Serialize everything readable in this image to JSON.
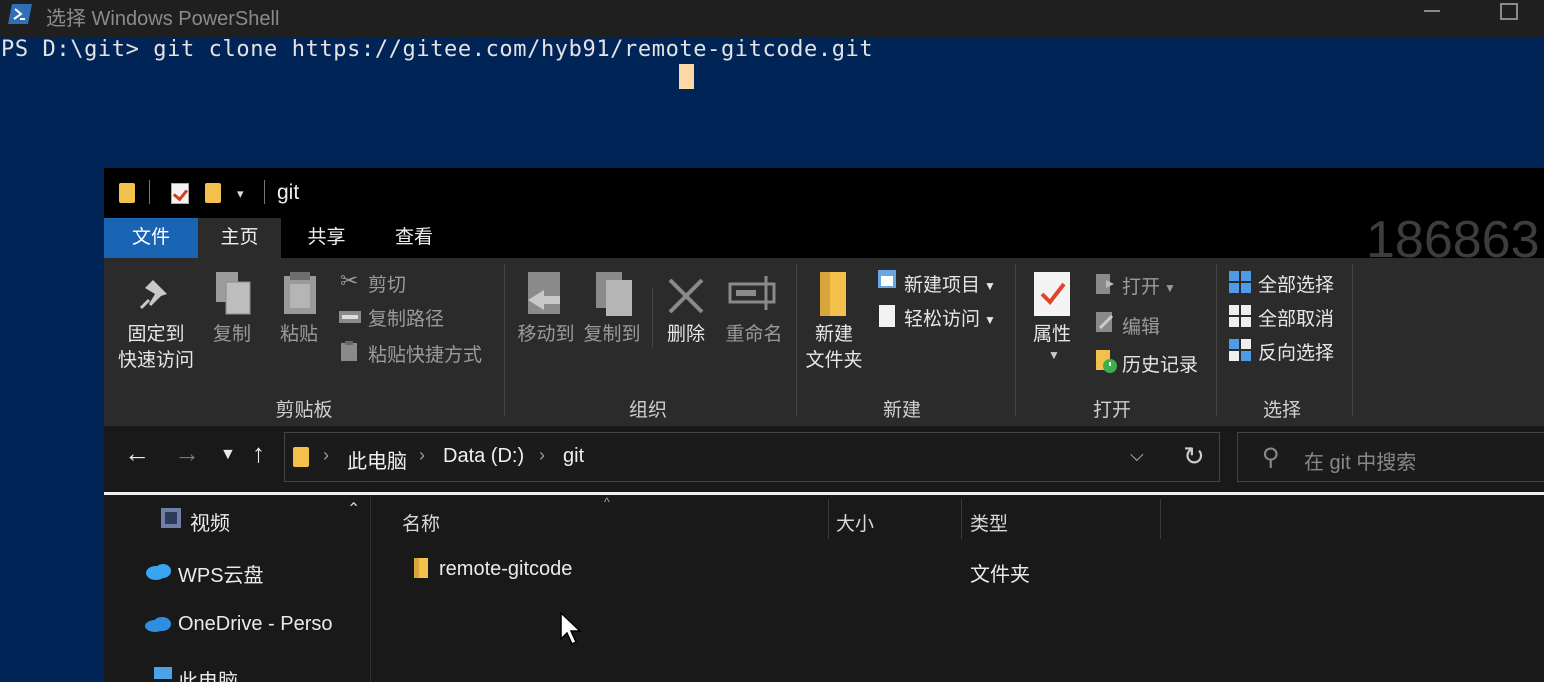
{
  "powershell": {
    "title": "选择 Windows PowerShell",
    "prompt": "PS D:\\git>",
    "command": " git clone https://gitee.com/hyb91/remote-gitcode.git"
  },
  "explorer": {
    "title": "git",
    "watermark": "186863",
    "tabs": [
      "文件",
      "主页",
      "共享",
      "查看"
    ],
    "ribbon": {
      "clipboard": {
        "pin_line1": "固定到",
        "pin_line2": "快速访问",
        "copy": "复制",
        "paste": "粘贴",
        "cut": "剪切",
        "copy_path": "复制路径",
        "paste_shortcut": "粘贴快捷方式",
        "label": "剪贴板"
      },
      "organize": {
        "move_to": "移动到",
        "copy_to": "复制到",
        "delete": "删除",
        "rename": "重命名",
        "label": "组织"
      },
      "new": {
        "new_folder_line1": "新建",
        "new_folder_line2": "文件夹",
        "new_item": "新建项目",
        "easy_access": "轻松访问",
        "label": "新建"
      },
      "open": {
        "properties": "属性",
        "open": "打开",
        "edit": "编辑",
        "history": "历史记录",
        "label": "打开"
      },
      "select": {
        "select_all": "全部选择",
        "select_none": "全部取消",
        "invert": "反向选择",
        "label": "选择"
      }
    },
    "address": {
      "crumbs": [
        "此电脑",
        "Data (D:)",
        "git"
      ],
      "search_placeholder": "在 git 中搜索"
    },
    "nav_pane": [
      "视频",
      "WPS云盘",
      "OneDrive - Perso",
      "此电脑"
    ],
    "columns": [
      "名称",
      "大小",
      "类型"
    ],
    "files": [
      {
        "name": "remote-gitcode",
        "size": "",
        "type": "文件夹"
      }
    ]
  },
  "colors": {
    "powershell_bg": "#012456",
    "accent": "#1964b3",
    "folder": "#f3c04c"
  }
}
